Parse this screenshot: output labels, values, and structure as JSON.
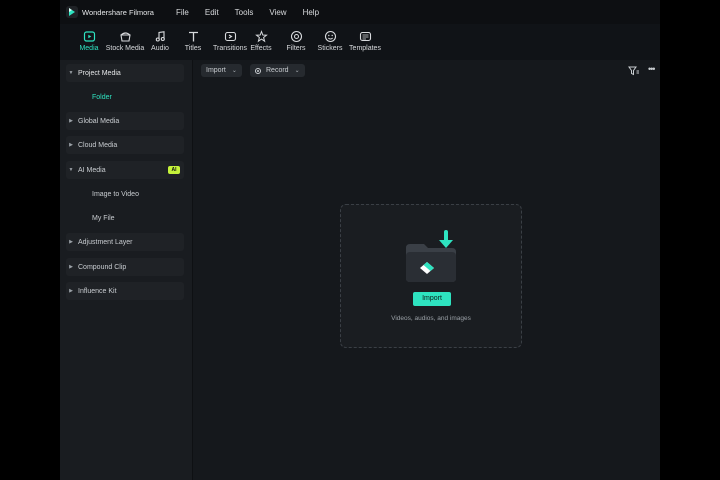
{
  "app": {
    "title": "Wondershare Filmora"
  },
  "menu": [
    "File",
    "Edit",
    "Tools",
    "View",
    "Help"
  ],
  "toolbar": {
    "tabs": [
      {
        "label": "Media",
        "icon": "media-icon",
        "active": true
      },
      {
        "label": "Stock Media",
        "icon": "stock-media-icon"
      },
      {
        "label": "Audio",
        "icon": "music-note-icon"
      },
      {
        "label": "Titles",
        "icon": "text-t-icon"
      },
      {
        "label": "Transitions",
        "icon": "transitions-icon"
      },
      {
        "label": "Effects",
        "icon": "effects-icon"
      },
      {
        "label": "Filters",
        "icon": "filters-icon"
      },
      {
        "label": "Stickers",
        "icon": "stickers-icon"
      },
      {
        "label": "Templates",
        "icon": "templates-icon"
      }
    ]
  },
  "sidebar": {
    "items": [
      {
        "label": "Project Media",
        "type": "section",
        "expanded": true
      },
      {
        "label": "Folder",
        "type": "sub",
        "selected": true
      },
      {
        "label": "Global Media",
        "type": "section"
      },
      {
        "label": "Cloud Media",
        "type": "section"
      },
      {
        "label": "AI Media",
        "type": "section",
        "badge": "AI"
      },
      {
        "label": "Image to Video",
        "type": "sub"
      },
      {
        "label": "My File",
        "type": "sub"
      },
      {
        "label": "Adjustment Layer",
        "type": "section"
      },
      {
        "label": "Compound Clip",
        "type": "section"
      },
      {
        "label": "Influence Kit",
        "type": "section"
      }
    ]
  },
  "main": {
    "import_label": "Import",
    "record_label": "Record",
    "dropzone": {
      "button_label": "Import",
      "hint": "Videos, audios, and images"
    }
  },
  "colors": {
    "accent": "#2ee3c0",
    "ai_badge": "#c5f23a",
    "background": "#15181c"
  }
}
